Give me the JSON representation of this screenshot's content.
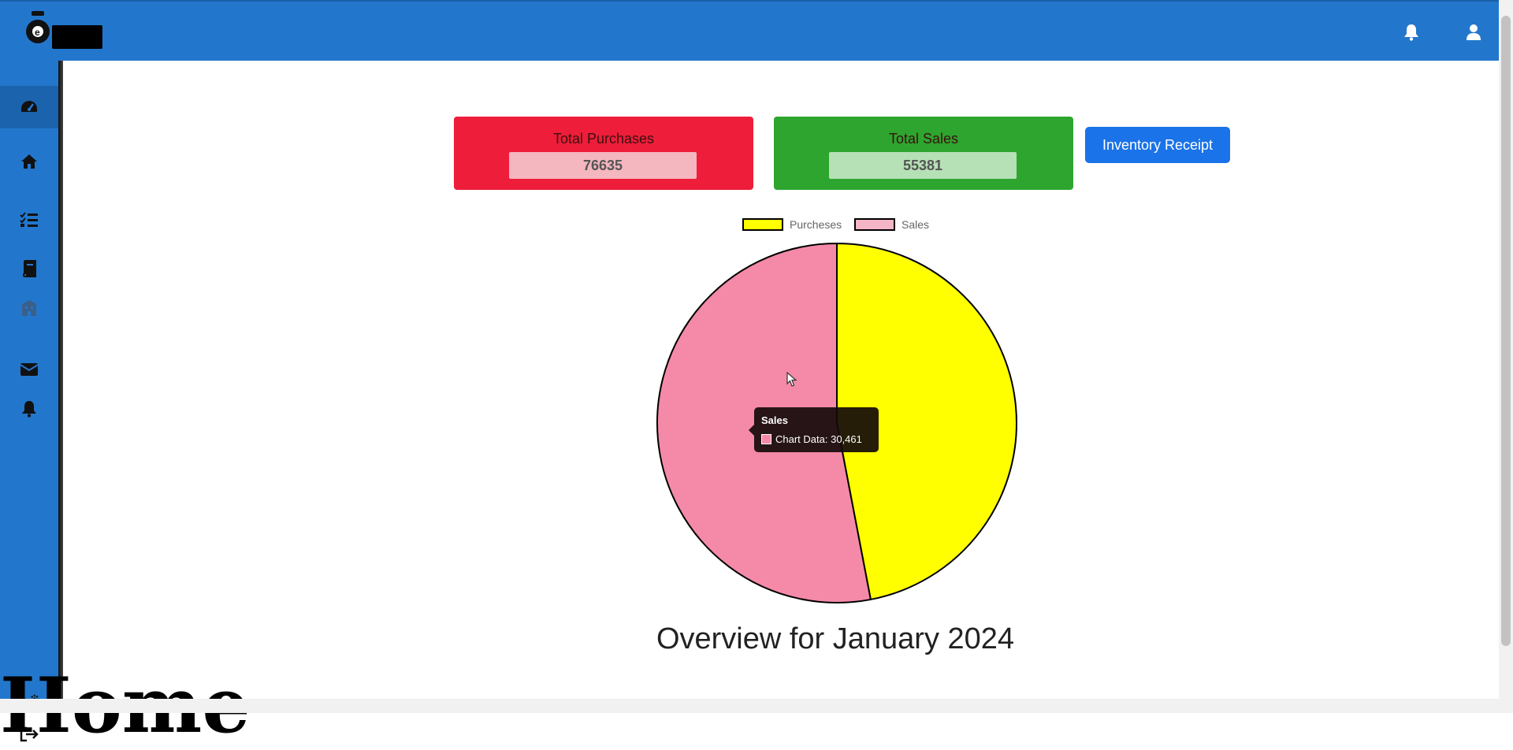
{
  "header": {
    "icons": [
      "bell-icon",
      "user-icon"
    ]
  },
  "sidebar": {
    "items": [
      {
        "icon": "dashboard-icon",
        "active": true
      },
      {
        "icon": "home-icon",
        "active": false
      },
      {
        "icon": "checklist-icon",
        "active": false
      },
      {
        "icon": "book-icon",
        "active": false
      },
      {
        "icon": "building-icon",
        "active": false
      },
      {
        "icon": "envelope-icon",
        "active": false
      },
      {
        "icon": "bell-icon",
        "active": false
      },
      {
        "icon": "gears-icon",
        "active": false
      },
      {
        "icon": "logout-icon",
        "active": false
      }
    ]
  },
  "cards": {
    "purchases": {
      "title": "Total Purchases",
      "value": "76635",
      "color": "#ee1d3a"
    },
    "sales": {
      "title": "Total Sales",
      "value": "55381",
      "color": "#2ea52e"
    }
  },
  "actions": {
    "receipt_label": "Inventory Receipt"
  },
  "chart_data": {
    "type": "pie",
    "categories": [
      "Purcheses",
      "Sales"
    ],
    "values": [
      27000,
      30461
    ],
    "colors": [
      "#ffff00",
      "#f48aa8"
    ],
    "legend": "top",
    "tooltip": {
      "title": "Sales",
      "label": "Chart Data",
      "value": "30,461"
    }
  },
  "overview": {
    "title": "Overview for January 2024"
  },
  "overlay": {
    "text": "Home"
  }
}
